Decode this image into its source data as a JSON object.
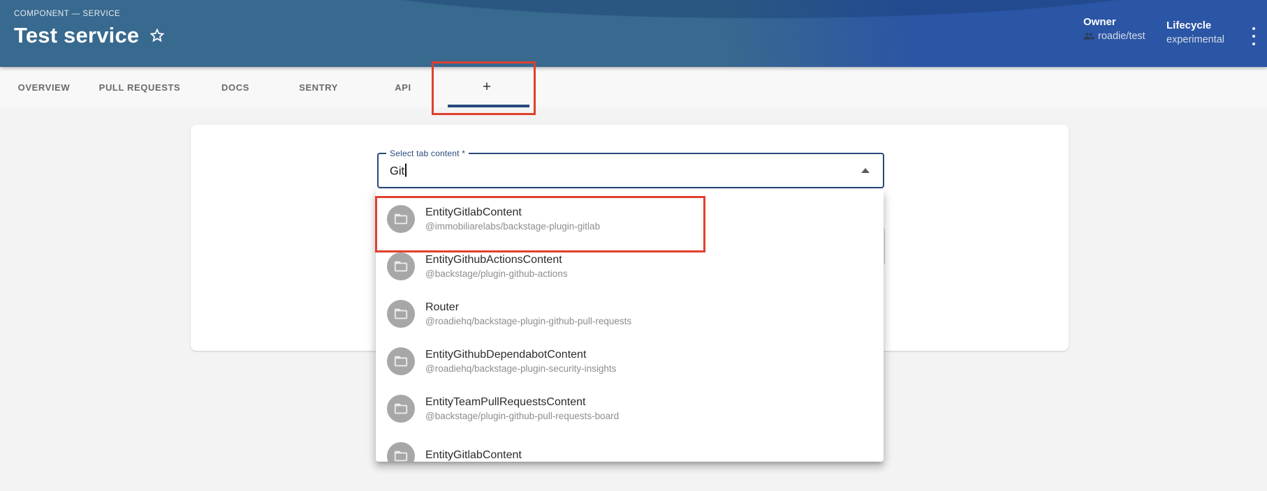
{
  "header": {
    "eyebrow": "COMPONENT — SERVICE",
    "title": "Test service",
    "owner": {
      "label": "Owner",
      "value": "roadie/test"
    },
    "lifecycle": {
      "label": "Lifecycle",
      "value": "experimental"
    }
  },
  "tabs": {
    "items": [
      {
        "label": "OVERVIEW"
      },
      {
        "label": "PULL REQUESTS"
      },
      {
        "label": "DOCS"
      },
      {
        "label": "SENTRY"
      },
      {
        "label": "API"
      },
      {
        "label": "+"
      }
    ]
  },
  "form": {
    "select_label": "Select tab content *",
    "select_value": "Git"
  },
  "dropdown": {
    "options": [
      {
        "title": "EntityGitlabContent",
        "subtitle": "@immobiliarelabs/backstage-plugin-gitlab"
      },
      {
        "title": "EntityGithubActionsContent",
        "subtitle": "@backstage/plugin-github-actions"
      },
      {
        "title": "Router",
        "subtitle": "@roadiehq/backstage-plugin-github-pull-requests"
      },
      {
        "title": "EntityGithubDependabotContent",
        "subtitle": "@roadiehq/backstage-plugin-security-insights"
      },
      {
        "title": "EntityTeamPullRequestsContent",
        "subtitle": "@backstage/plugin-github-pull-requests-board"
      },
      {
        "title": "EntityGitlabContent",
        "subtitle": ""
      }
    ]
  },
  "colors": {
    "accent_navy": "#27497c",
    "annotation_red": "#e0402e",
    "header_left": "#38698f",
    "header_right": "#2b55a5"
  }
}
